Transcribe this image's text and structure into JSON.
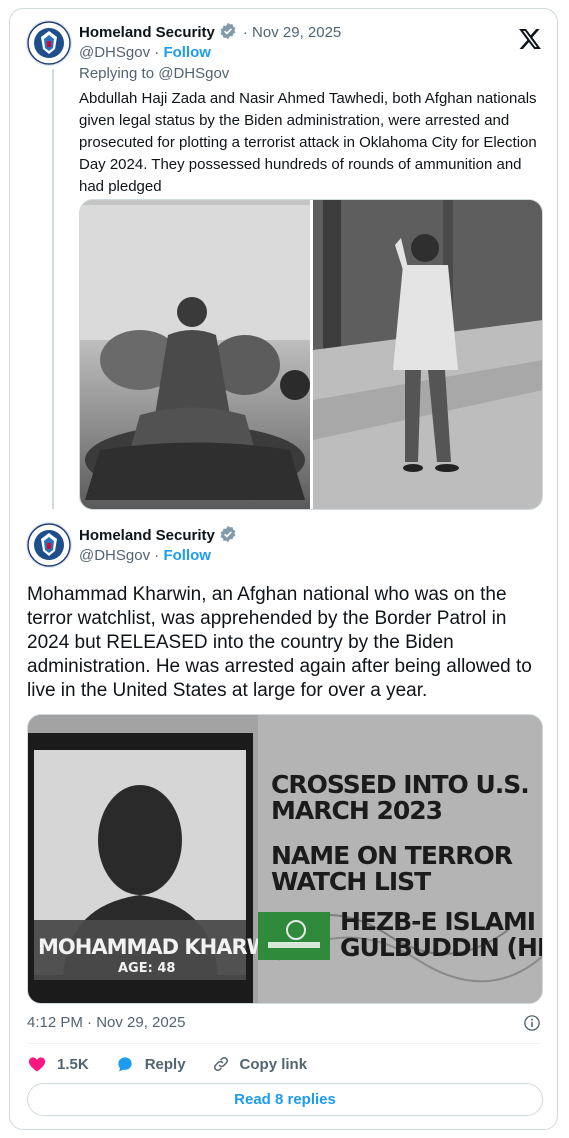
{
  "tweet1": {
    "author": "Homeland Security",
    "handle": "@DHSgov",
    "separator": " · ",
    "follow": "Follow",
    "date_prefix": "· ",
    "date": "Nov 29, 2025",
    "replying": "Replying to @DHSgov",
    "text": "Abdullah Haji Zada and Nasir Ahmed Tawhedi, both Afghan nationals given legal status by the Biden administration, were arrested and prosecuted for plotting a terrorist attack in Oklahoma City for Election Day 2024. They possessed hundreds of rounds of ammunition and had pledged"
  },
  "tweet2": {
    "author": "Homeland Security",
    "handle": "@DHSgov",
    "separator": " · ",
    "follow": "Follow",
    "text": "Mohammad Kharwin, an Afghan national who was on the terror watchlist, was apprehended by the Border Patrol in 2024 but RELEASED into the country by the Biden administration. He was arrested again after being allowed to live in the United States at large for over a year.",
    "graphic": {
      "name_line": "MOHAMMAD KHARWIN",
      "age_line": "AGE: 48",
      "line1": "CROSSED INTO U.S.",
      "line2": "MARCH 2023",
      "line3": "NAME ON TERROR",
      "line4": "WATCH LIST",
      "line5": "HEZB-E ISLAMI",
      "line6": "GULBUDDIN (HIG)"
    },
    "timestamp": "4:12 PM · Nov 29, 2025",
    "likes": "1.5K",
    "reply_label": "Reply",
    "copy_label": "Copy link",
    "read_replies": "Read 8 replies"
  },
  "colors": {
    "accent": "#1d9bf0",
    "like": "#f91880",
    "muted": "#536471"
  },
  "icons": [
    "verified-badge-icon",
    "x-logo-icon",
    "info-icon",
    "heart-icon",
    "reply-bubble-icon",
    "link-icon",
    "dhs-seal-icon"
  ]
}
